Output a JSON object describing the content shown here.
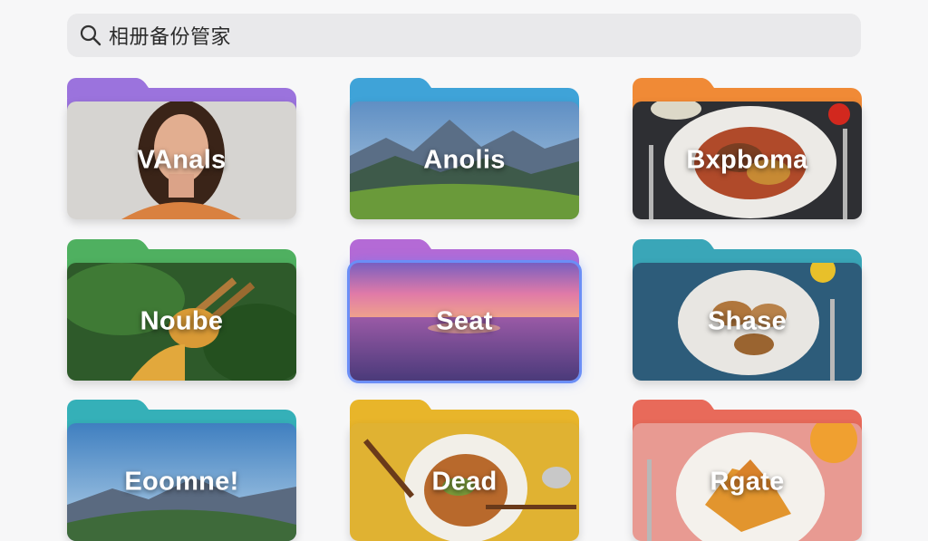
{
  "search": {
    "text": "相册备份管家"
  },
  "folders": [
    {
      "label": "VAnals",
      "color": "#9b73dd",
      "image": "portrait-woman"
    },
    {
      "label": "Anolis",
      "color": "#3fa3d8",
      "image": "mountain-landscape"
    },
    {
      "label": "Bxpboma",
      "color": "#f08a36",
      "image": "plated-food"
    },
    {
      "label": "Noube",
      "color": "#4fb060",
      "image": "chopsticks-food"
    },
    {
      "label": "Seat",
      "color": "#b46ad6",
      "image": "sunset-sea",
      "selected": true
    },
    {
      "label": "Shase",
      "color": "#3aa6b8",
      "image": "plated-food"
    },
    {
      "label": "Eoomne!",
      "color": "#35b0b8",
      "image": "mountain-landscape"
    },
    {
      "label": "Dead",
      "color": "#e8b52a",
      "image": "noodle-bowl"
    },
    {
      "label": "Rgate",
      "color": "#e86a5a",
      "image": "plated-food"
    }
  ]
}
